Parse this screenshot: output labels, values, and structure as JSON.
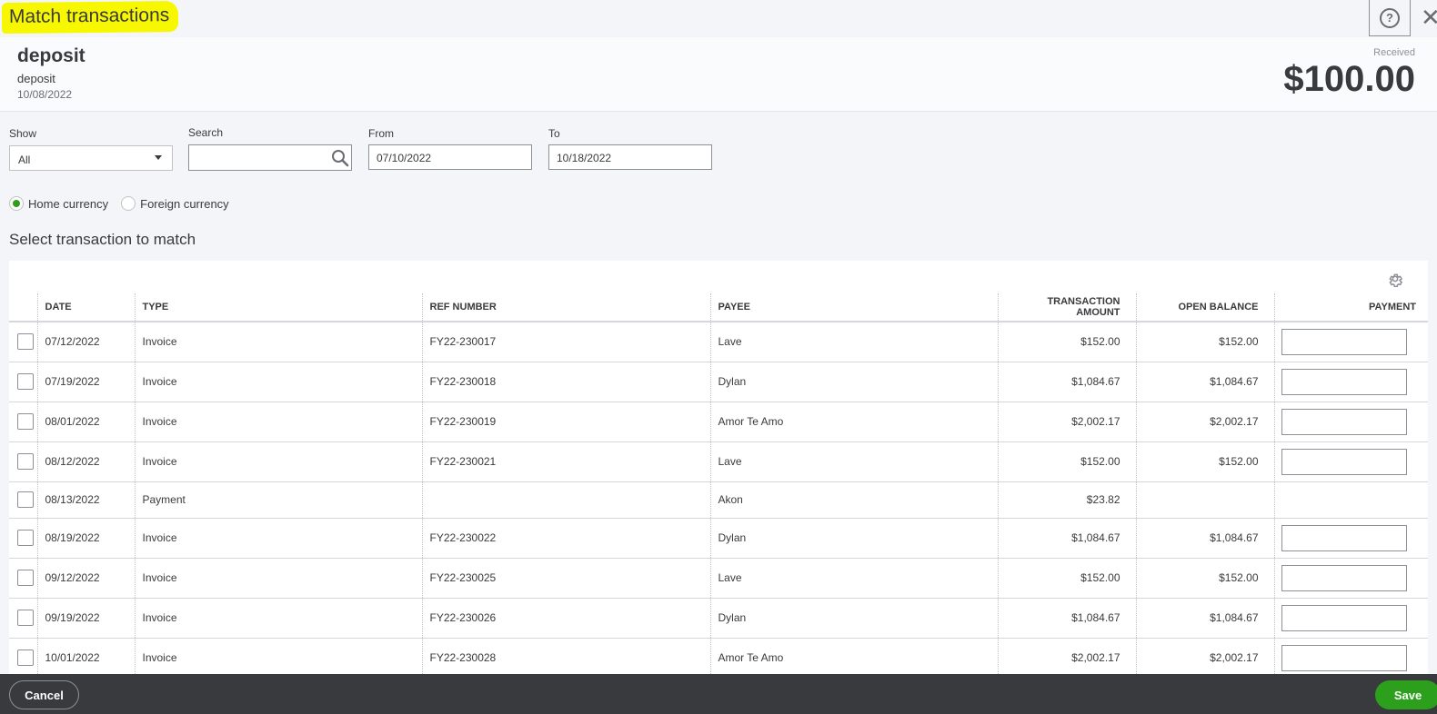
{
  "dialog": {
    "title": "Match transactions",
    "help_icon": "help-icon",
    "close_glyph": "✕"
  },
  "deposit": {
    "title": "deposit",
    "subtitle": "deposit",
    "date": "10/08/2022",
    "received_label": "Received",
    "amount": "$100.00"
  },
  "filters": {
    "show_label": "Show",
    "show_value": "All",
    "search_label": "Search",
    "search_value": "",
    "from_label": "From",
    "from_value": "07/10/2022",
    "to_label": "To",
    "to_value": "10/18/2022"
  },
  "currency": {
    "home": "Home currency",
    "foreign": "Foreign currency",
    "selected": "home"
  },
  "section_heading": "Select transaction to match",
  "table": {
    "columns": [
      "DATE",
      "TYPE",
      "REF NUMBER",
      "PAYEE",
      "TRANSACTION AMOUNT",
      "OPEN BALANCE",
      "PAYMENT"
    ],
    "rows": [
      {
        "date": "07/12/2022",
        "type": "Invoice",
        "ref": "FY22-230017",
        "payee": "Lave",
        "amount": "$152.00",
        "open": "$152.00",
        "payment": true
      },
      {
        "date": "07/19/2022",
        "type": "Invoice",
        "ref": "FY22-230018",
        "payee": "Dylan",
        "amount": "$1,084.67",
        "open": "$1,084.67",
        "payment": true
      },
      {
        "date": "08/01/2022",
        "type": "Invoice",
        "ref": "FY22-230019",
        "payee": "Amor Te Amo",
        "amount": "$2,002.17",
        "open": "$2,002.17",
        "payment": true
      },
      {
        "date": "08/12/2022",
        "type": "Invoice",
        "ref": "FY22-230021",
        "payee": "Lave",
        "amount": "$152.00",
        "open": "$152.00",
        "payment": true
      },
      {
        "date": "08/13/2022",
        "type": "Payment",
        "ref": "",
        "payee": "Akon",
        "amount": "$23.82",
        "open": "",
        "payment": false
      },
      {
        "date": "08/19/2022",
        "type": "Invoice",
        "ref": "FY22-230022",
        "payee": "Dylan",
        "amount": "$1,084.67",
        "open": "$1,084.67",
        "payment": true
      },
      {
        "date": "09/12/2022",
        "type": "Invoice",
        "ref": "FY22-230025",
        "payee": "Lave",
        "amount": "$152.00",
        "open": "$152.00",
        "payment": true
      },
      {
        "date": "09/19/2022",
        "type": "Invoice",
        "ref": "FY22-230026",
        "payee": "Dylan",
        "amount": "$1,084.67",
        "open": "$1,084.67",
        "payment": true
      },
      {
        "date": "10/01/2022",
        "type": "Invoice",
        "ref": "FY22-230028",
        "payee": "Amor Te Amo",
        "amount": "$2,002.17",
        "open": "$2,002.17",
        "payment": true
      }
    ]
  },
  "footer": {
    "cancel": "Cancel",
    "save": "Save"
  },
  "colors": {
    "accent": "#2ca01c",
    "highlight": "#f7f700",
    "footer_bg": "#393a3d"
  }
}
